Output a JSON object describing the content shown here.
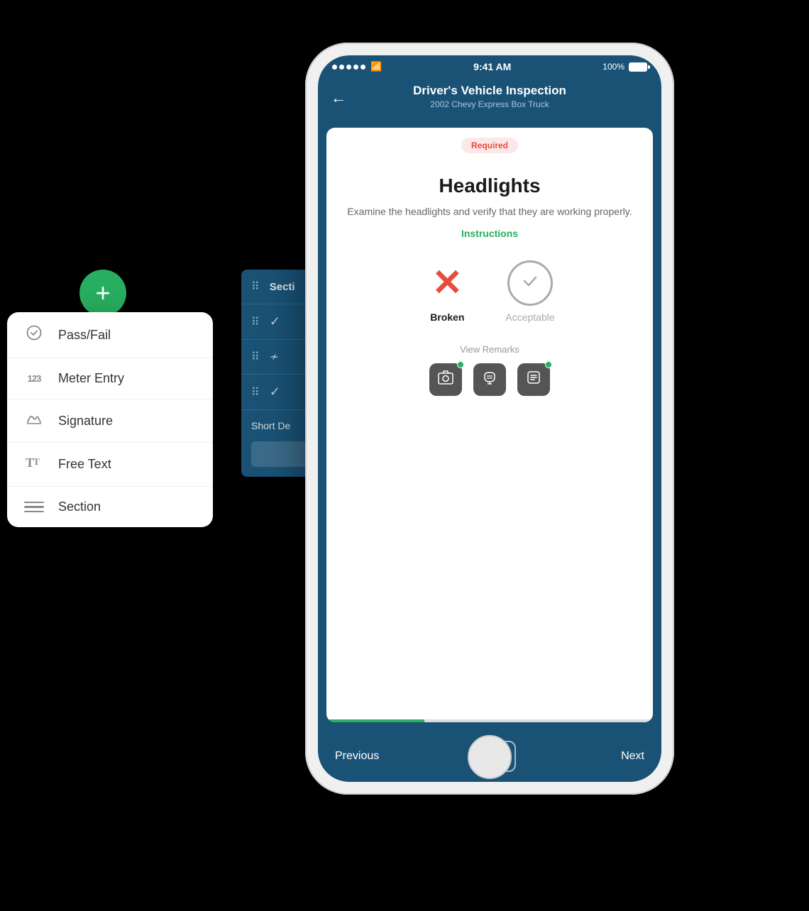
{
  "background": {
    "color": "#000000"
  },
  "phone": {
    "status_bar": {
      "signals": 5,
      "wifi": "wifi",
      "time": "9:41 AM",
      "battery": "100%"
    },
    "nav": {
      "title": "Driver's Vehicle Inspection",
      "subtitle": "2002 Chevy Express Box Truck",
      "back_label": "←"
    },
    "card": {
      "required_badge": "Required",
      "item_title": "Headlights",
      "item_description": "Examine the headlights and verify that they are working properly.",
      "instructions_label": "Instructions",
      "choice_broken": "Broken",
      "choice_acceptable": "Acceptable",
      "view_remarks": "View Remarks"
    },
    "bottom_nav": {
      "previous": "Previous",
      "next": "Next",
      "center_icon": "+"
    }
  },
  "add_button": {
    "label": "+"
  },
  "popup_menu": {
    "items": [
      {
        "id": "pass-fail",
        "icon_type": "check",
        "label": "Pass/Fail"
      },
      {
        "id": "meter-entry",
        "icon_type": "number",
        "label": "Meter Entry"
      },
      {
        "id": "signature",
        "icon_type": "signature",
        "label": "Signature"
      },
      {
        "id": "free-text",
        "icon_type": "text",
        "label": "Free Text"
      },
      {
        "id": "section",
        "icon_type": "lines",
        "label": "Section"
      }
    ]
  },
  "bg_panel": {
    "title": "Secti",
    "rows": [
      {
        "icon": "check"
      },
      {
        "icon": "signature"
      },
      {
        "icon": "check"
      }
    ],
    "short_desc": "Short De"
  }
}
